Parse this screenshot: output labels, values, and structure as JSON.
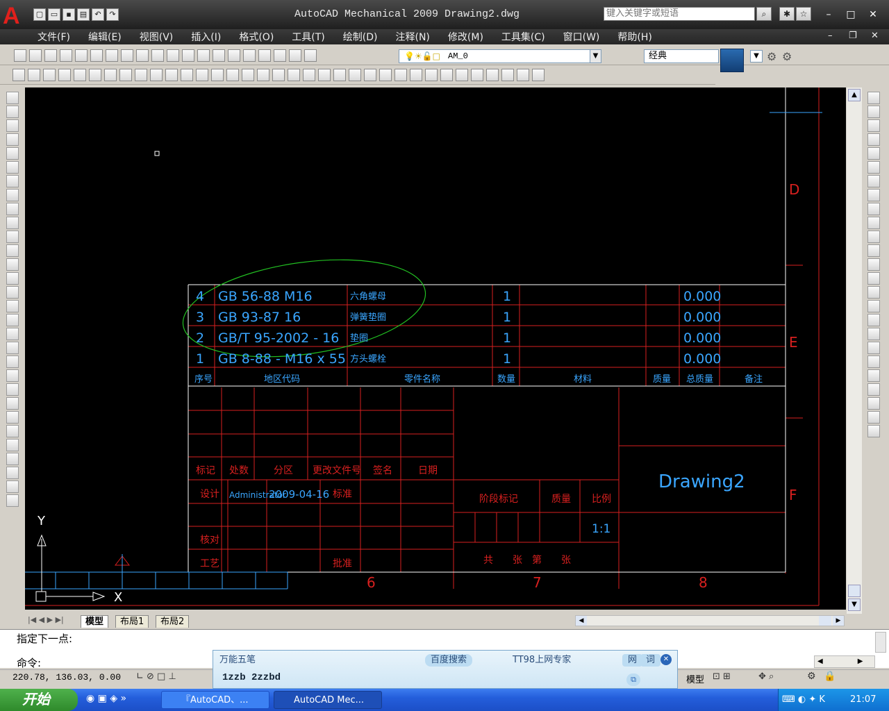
{
  "app": {
    "title": "AutoCAD Mechanical 2009 Drawing2.dwg",
    "search_placeholder": "键入关键字或短语"
  },
  "menu": [
    "文件(F)",
    "编辑(E)",
    "视图(V)",
    "插入(I)",
    "格式(O)",
    "工具(T)",
    "绘制(D)",
    "注释(N)",
    "修改(M)",
    "工具集(C)",
    "窗口(W)",
    "帮助(H)"
  ],
  "toolbar": {
    "layer_name": "AM_0",
    "workspace": "经典"
  },
  "drawing": {
    "bom": [
      {
        "no": "4",
        "code": "GB 56-88 M16",
        "name": "六角螺母",
        "qty": "1",
        "mass": "0.000"
      },
      {
        "no": "3",
        "code": "GB 93-87 16",
        "name": "弹簧垫圈",
        "qty": "1",
        "mass": "0.000"
      },
      {
        "no": "2",
        "code": "GB/T 95-2002 - 16",
        "name": "垫圈",
        "qty": "1",
        "mass": "0.000"
      },
      {
        "no": "1",
        "code": "GB 8-88 - M16 x 55",
        "name": "方头螺栓",
        "qty": "1",
        "mass": "0.000"
      }
    ],
    "bom_header": {
      "no": "序号",
      "code": "地区代码",
      "name": "零件名称",
      "qty": "数量",
      "material": "材料",
      "weight": "质量",
      "total": "总质量",
      "remark": "备注"
    },
    "title_block": {
      "mark": "标记",
      "count": "处数",
      "zone": "分区",
      "change_doc": "更改文件号",
      "sign": "签名",
      "date": "日期",
      "design": "设计",
      "designer": "Administrator",
      "design_date": "2009-04-16",
      "standard": "标准",
      "stage": "阶段标记",
      "mass": "质量",
      "scale_label": "比例",
      "scale": "1:1",
      "check": "核对",
      "process": "工艺",
      "approve": "批准",
      "sheet": "共　　张　第　　张",
      "drawing_name": "Drawing2"
    },
    "zones_right": [
      "D",
      "E",
      "F"
    ],
    "zones_bottom": [
      "6",
      "7",
      "8"
    ],
    "ucs": {
      "y": "Y",
      "x": "X"
    }
  },
  "tabs": {
    "model": "模型",
    "layout1": "布局1",
    "layout2": "布局2"
  },
  "command": {
    "line1": "指定下一点:",
    "line2": "命令:"
  },
  "status": {
    "coords": "220.78, 136.03, 0.00",
    "model": "模型"
  },
  "ime": {
    "title": "万能五笔",
    "baidu": "百度搜索",
    "tt98": "TT98上网专家",
    "net": "网",
    "word": "词",
    "input": "1zzb 2zzbd"
  },
  "taskbar": {
    "start": "开始",
    "task1": "『AutoCAD、...",
    "task2": "AutoCAD Mec...",
    "clock": "21:07"
  },
  "colors": {
    "cad_red": "#d8201f",
    "cad_cyan": "#3aa6ff",
    "canvas": "#000000"
  }
}
